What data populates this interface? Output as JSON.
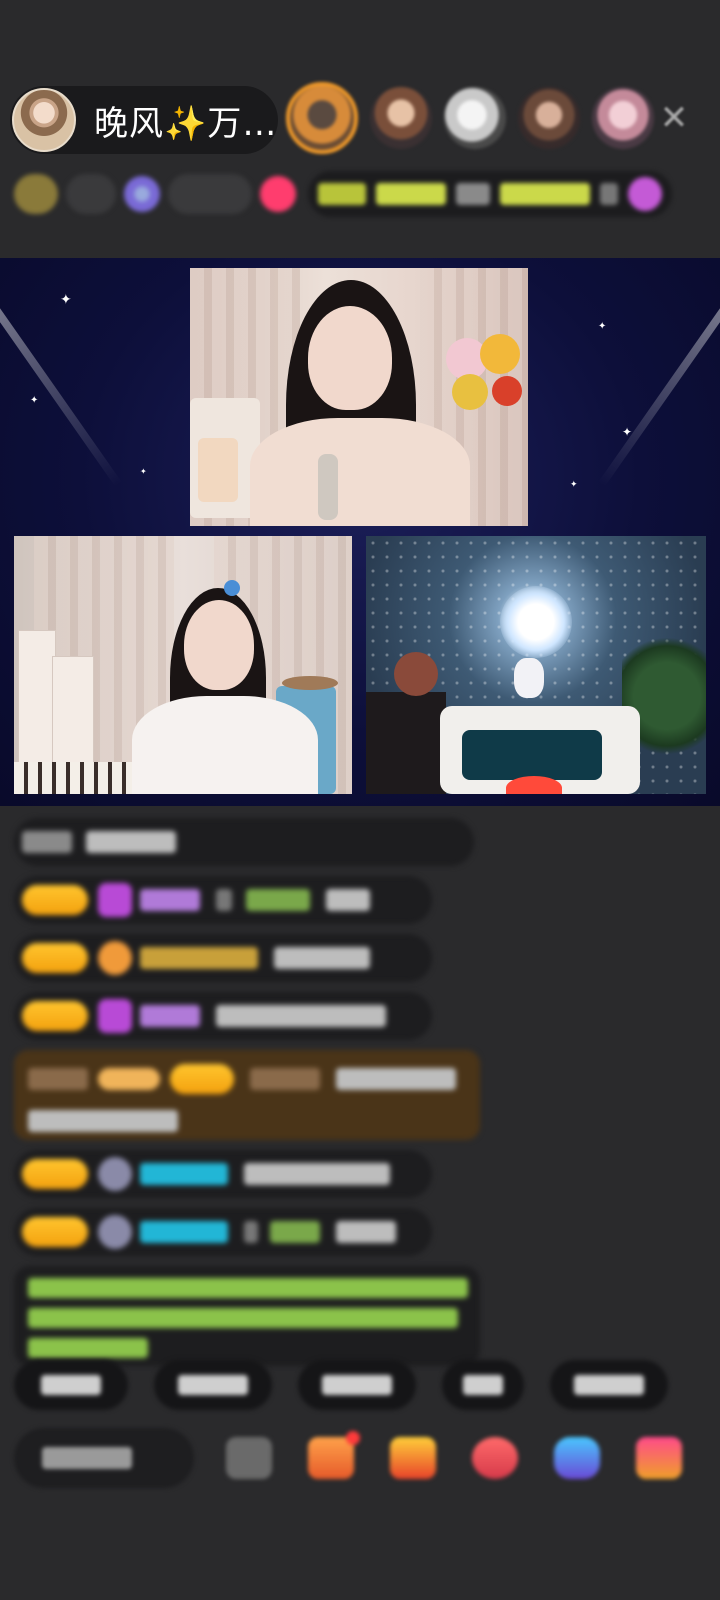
{
  "header": {
    "host_name": "晚风✨万…",
    "host_avatar_icon": "host-avatar",
    "close_icon": "close-icon",
    "viewers": [
      "viewer-avatar-1",
      "viewer-avatar-2",
      "viewer-avatar-3",
      "viewer-avatar-4",
      "viewer-avatar-5"
    ]
  },
  "colors": {
    "accent_orange": "#f19a2a",
    "badge_gold": "#ffc52e",
    "stage_navy": "#0d0f3a",
    "chat_bg": "#1d1d1f",
    "highlight_msg_bg": "#4a3418",
    "cyan_name": "#22b6d6",
    "purple_name": "#a97ad6",
    "green_text": "#8bc34a"
  },
  "stage": {
    "camera_main": "main-cam-video",
    "camera_left": "left-cam-video",
    "camera_right": "right-cam-video",
    "watermark_icon": "gift-tag-icon"
  },
  "chat": {
    "messages": [
      "msg-1",
      "msg-2",
      "msg-3",
      "msg-4",
      "msg-5",
      "msg-6",
      "msg-7",
      "msg-8"
    ]
  },
  "toolbar": {
    "icons": [
      "emoji-icon",
      "gift-box-icon",
      "treasure-icon",
      "red-pack-icon",
      "game-icon",
      "gift-icon"
    ]
  }
}
